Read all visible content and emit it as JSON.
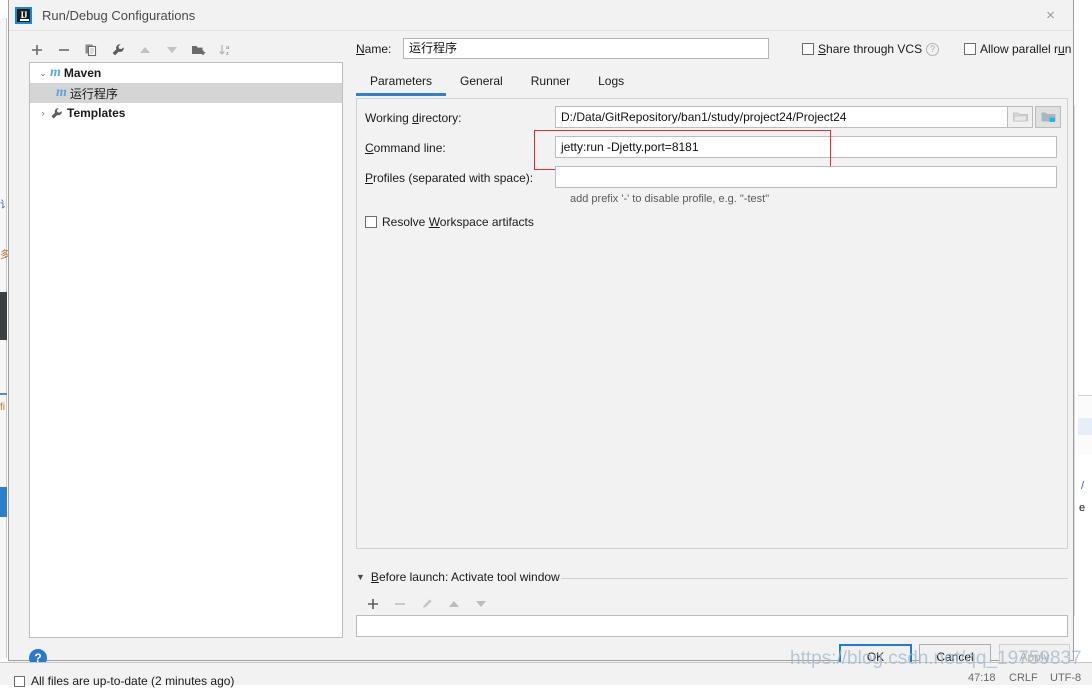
{
  "window": {
    "title": "Run/Debug Configurations",
    "app_icon": "intellij-idea-logo-icon",
    "close_icon": "×"
  },
  "left_toolbar": {
    "buttons": [
      {
        "name": "add-configuration-button",
        "icon": "plus-icon",
        "glyph": "+"
      },
      {
        "name": "remove-configuration-button",
        "icon": "minus-icon",
        "glyph": "−"
      },
      {
        "name": "copy-configuration-button",
        "icon": "copy-icon",
        "glyph": "copy"
      },
      {
        "name": "edit-templates-button",
        "icon": "wrench-icon",
        "glyph": "wrench"
      },
      {
        "name": "move-up-button",
        "icon": "arrow-up-icon",
        "glyph": "▲"
      },
      {
        "name": "move-down-button",
        "icon": "arrow-down-icon",
        "glyph": "▼"
      },
      {
        "name": "create-folder-button",
        "icon": "folder-add-icon",
        "glyph": "folder+"
      },
      {
        "name": "sort-configurations-button",
        "icon": "sort-alpha-icon",
        "glyph": "sort-az"
      }
    ]
  },
  "tree": {
    "nodes": [
      {
        "label": "Maven",
        "icon": "maven-m-icon",
        "expanded": true,
        "chevron": "⌄",
        "bold": true,
        "indent": 0,
        "selected": false
      },
      {
        "label": "运行程序",
        "icon": "maven-m-icon",
        "expanded": false,
        "chevron": "",
        "bold": false,
        "indent": 1,
        "selected": true
      },
      {
        "label": "Templates",
        "icon": "wrench-icon",
        "expanded": false,
        "chevron": "›",
        "bold": true,
        "indent": 0,
        "selected": false
      }
    ]
  },
  "name_row": {
    "label": "Name:",
    "label_mnemonic": "N",
    "value": "运行程序",
    "share_vcs_label": "Share through VCS",
    "share_vcs_mnemonic": "S",
    "share_vcs_checked": false,
    "share_vcs_help_icon": "question-icon",
    "allow_parallel_label": "Allow parallel run",
    "allow_parallel_mnemonic": "r",
    "allow_parallel_checked": false
  },
  "tabs": {
    "items": [
      {
        "label": "Parameters",
        "active": true
      },
      {
        "label": "General",
        "active": false
      },
      {
        "label": "Runner",
        "active": false
      },
      {
        "label": "Logs",
        "active": false
      }
    ]
  },
  "parameters": {
    "working_directory": {
      "label": "Working directory:",
      "label_mnemonic": "d",
      "value": "D:/Data/GitRepository/ban1/study/project24/Project24",
      "browse_folder_icon": "folder-icon",
      "browse_module_icon": "module-folder-icon"
    },
    "command_line": {
      "label": "Command line:",
      "label_mnemonic": "C",
      "value": "jetty:run -Djetty.port=8181",
      "highlighted": true,
      "highlight_color": "#e03030"
    },
    "profiles": {
      "label": "Profiles (separated with space):",
      "label_mnemonic": "P",
      "value": "",
      "hint": "add prefix '-' to disable profile, e.g. \"-test\""
    },
    "resolve_workspace_artifacts": {
      "label": "Resolve Workspace artifacts",
      "label_mnemonic": "W",
      "checked": false
    }
  },
  "before_launch": {
    "triangle": "▼",
    "title": "Before launch: Activate tool window",
    "title_mnemonic": "B",
    "toolbar": [
      {
        "name": "before-launch-add-button",
        "icon": "plus-icon",
        "glyph": "+",
        "enabled": true
      },
      {
        "name": "before-launch-remove-button",
        "icon": "minus-icon",
        "glyph": "−",
        "enabled": false
      },
      {
        "name": "before-launch-edit-button",
        "icon": "pencil-icon",
        "glyph": "pencil",
        "enabled": false
      },
      {
        "name": "before-launch-move-up-button",
        "icon": "arrow-up-icon",
        "glyph": "▲",
        "enabled": false
      },
      {
        "name": "before-launch-move-down-button",
        "icon": "arrow-down-icon",
        "glyph": "▼",
        "enabled": false
      }
    ],
    "list_items": []
  },
  "footer": {
    "help_icon": "question-icon",
    "help_glyph": "?",
    "ok_label": "OK",
    "cancel_label": "Cancel",
    "apply_label": "Apply",
    "apply_enabled": false
  },
  "status_bar": {
    "checkbox_checked": false,
    "message": "All files are up-to-date (2 minutes ago)",
    "caret_position": "47:18",
    "line_separator": "CRLF",
    "encoding": "UTF-8"
  },
  "watermark": {
    "text": "https://blog.csdn.net/qq_19759837"
  },
  "colors": {
    "accent_blue": "#2f80d4",
    "maven_icon_blue": "#5aa8d8",
    "highlight_red": "#e03030",
    "selection_gray": "#d5d5d5",
    "dialog_bg": "#f2f2f2"
  }
}
